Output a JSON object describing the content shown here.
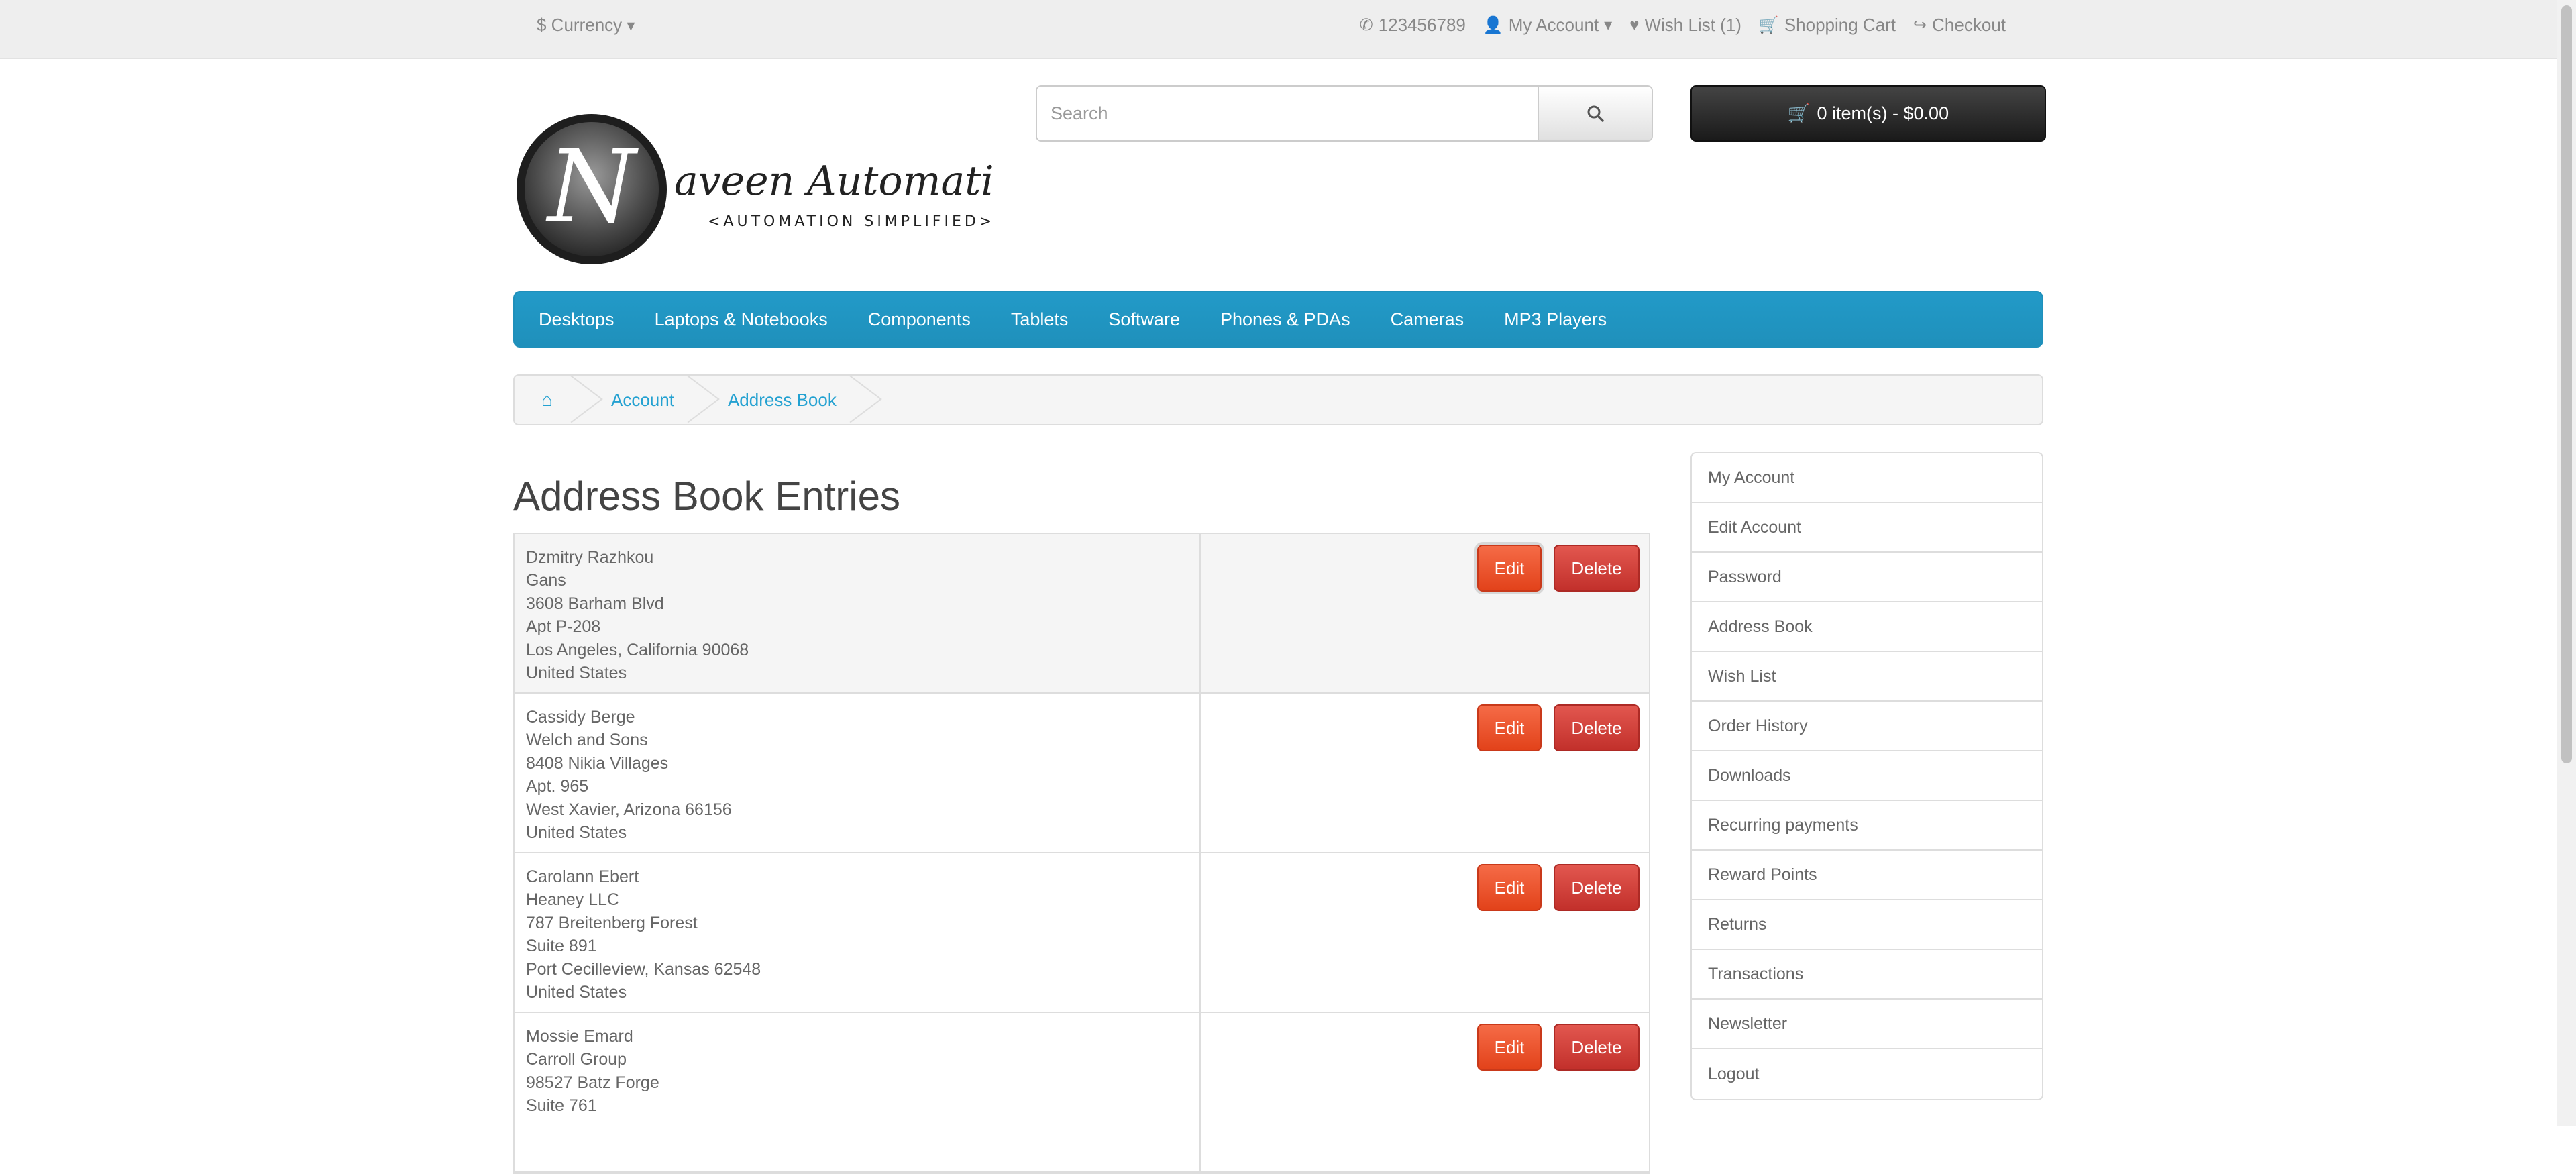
{
  "top_bar": {
    "currency": "$ Currency",
    "phone": "123456789",
    "my_account": "My Account",
    "wishlist": "Wish List (1)",
    "shopping_cart": "Shopping Cart",
    "checkout": "Checkout"
  },
  "header": {
    "logo_text": "aveen Automation Labs",
    "logo_tagline": "<AUTOMATION SIMPLIFIED>",
    "search_placeholder": "Search",
    "cart_label": "0 item(s) - $0.00"
  },
  "menu": [
    "Desktops",
    "Laptops & Notebooks",
    "Components",
    "Tablets",
    "Software",
    "Phones & PDAs",
    "Cameras",
    "MP3 Players"
  ],
  "breadcrumb": [
    "Account",
    "Address Book"
  ],
  "page_title": "Address Book Entries",
  "entries": [
    {
      "lines": [
        "Dzmitry Razhkou",
        "Gans",
        "3608 Barham Blvd",
        "Apt P-208",
        "Los Angeles, California 90068",
        "United States"
      ]
    },
    {
      "lines": [
        "Cassidy Berge",
        "Welch and Sons",
        "8408 Nikia Villages",
        "Apt. 965",
        "West Xavier, Arizona 66156",
        "United States"
      ]
    },
    {
      "lines": [
        "Carolann Ebert",
        "Heaney LLC",
        "787 Breitenberg Forest",
        "Suite 891",
        "Port Cecilleview, Kansas 62548",
        "United States"
      ]
    },
    {
      "lines": [
        "Mossie Emard",
        "Carroll Group",
        "98527 Batz Forge",
        "Suite 761",
        "",
        ""
      ]
    }
  ],
  "entry_buttons": {
    "edit": "Edit",
    "delete": "Delete"
  },
  "sidebar": [
    "My Account",
    "Edit Account",
    "Password",
    "Address Book",
    "Wish List",
    "Order History",
    "Downloads",
    "Recurring payments",
    "Reward Points",
    "Returns",
    "Transactions",
    "Newsletter",
    "Logout"
  ],
  "colors": {
    "menu_blue": "#229ac8",
    "link_blue": "#23a1d1",
    "edit_orange": "#e9512b",
    "delete_red": "#cd3c36",
    "cart_dark": "#303030"
  }
}
